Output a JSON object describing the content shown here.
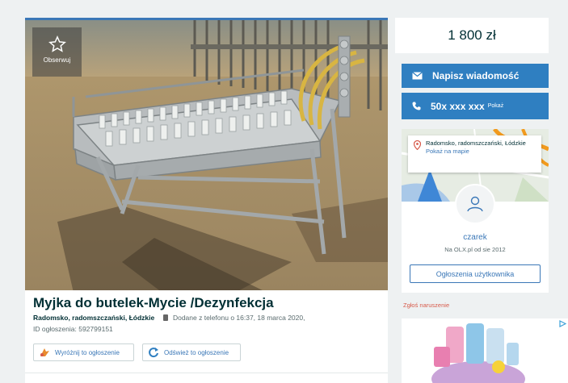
{
  "listing": {
    "watch_label": "Obserwuj",
    "title": "Myjka do butelek-Mycie /Dezynfekcja",
    "location": "Radomsko, radomszczański, Łódzkie",
    "added": "Dodane z telefonu   o 16:37, 18 marca 2020,",
    "ad_id": "ID ogłoszenia: 592799151",
    "feature_label": "Wyróżnij to ogłoszenie",
    "refresh_label": "Odśwież to ogłoszenie"
  },
  "sidebar": {
    "price": "1 800 zł",
    "message_label": "Napisz wiadomość",
    "phone": "50x xxx xxx",
    "phone_show": "Pokaż",
    "map_location": "Radomsko, radomszczański, Łódzkie",
    "map_link": "Pokaż na mapie",
    "username": "czarek",
    "member_since": "Na OLX.pl od sie 2012",
    "user_ads_label": "Ogłoszenia użytkownika",
    "report_label": "Zgłoś naruszenie"
  },
  "colors": {
    "accent": "#2f7fc1",
    "link": "#3a77b7",
    "report": "#d75a4a"
  },
  "icons": [
    "star-icon",
    "envelope-icon",
    "phone-icon",
    "pin-icon",
    "user-icon",
    "feature-icon",
    "refresh-icon",
    "ad-choices-icon"
  ]
}
